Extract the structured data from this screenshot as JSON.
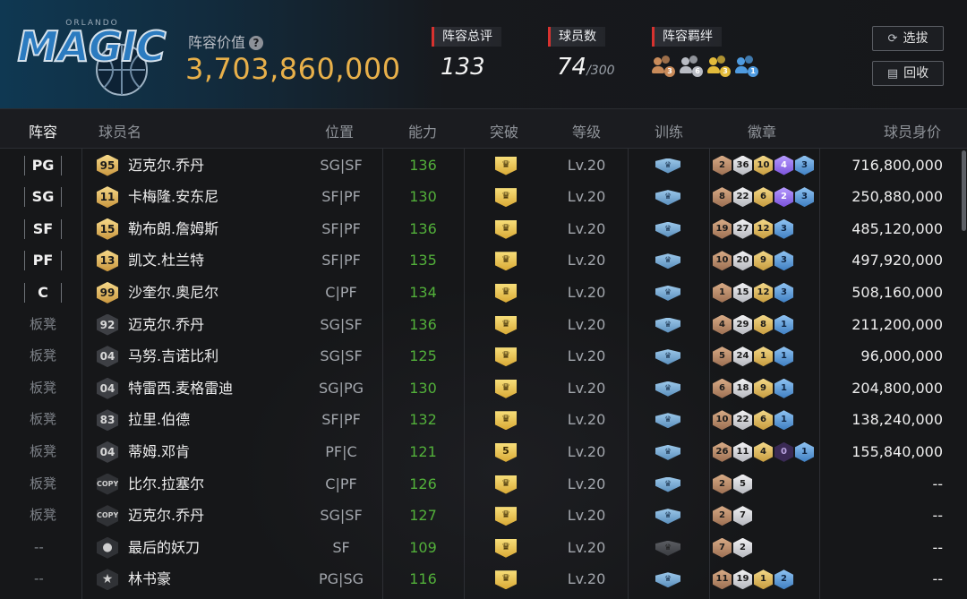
{
  "header": {
    "logo_text": "MAGIC",
    "logo_city": "ORLANDO",
    "lineup_value_label": "阵容价值",
    "lineup_value": "3,703,860,000",
    "stats": [
      {
        "label": "阵容总评",
        "value": "133",
        "sub": ""
      },
      {
        "label": "球员数",
        "value": "74",
        "sub": "/300"
      },
      {
        "label": "阵容羁绊",
        "value": "",
        "sub": ""
      }
    ],
    "bond_icons": [
      {
        "icon": "bronze-bond-icon",
        "badge": "3",
        "color": "#c98b5a"
      },
      {
        "icon": "silver-bond-icon",
        "badge": "6",
        "color": "#b9bcc4"
      },
      {
        "icon": "gold-bond-icon",
        "badge": "3",
        "color": "#e3bb3b"
      },
      {
        "icon": "blue-bond-icon",
        "badge": "1",
        "color": "#4f9be0"
      }
    ],
    "buttons": {
      "select": "选拔",
      "recycle": "回收"
    }
  },
  "columns": {
    "lineup": "阵容",
    "name": "球员名",
    "position": "位置",
    "rating": "能力",
    "breakthrough": "突破",
    "level": "等级",
    "training": "训练",
    "badges": "徽章",
    "salary": "球员身价"
  },
  "rows": [
    {
      "slot": "PG",
      "starter": true,
      "num": "95",
      "num_style": "gold",
      "name": "迈克尔.乔丹",
      "pos": "SG|SF",
      "rating": "136",
      "brk": "crown",
      "level": "Lv.20",
      "train": "normal",
      "badges": [
        {
          "v": "2",
          "t": "bronze"
        },
        {
          "v": "36",
          "t": "silver"
        },
        {
          "v": "10",
          "t": "gold"
        },
        {
          "v": "4",
          "t": "purple"
        },
        {
          "v": "3",
          "t": "blue"
        }
      ],
      "salary": "716,800,000"
    },
    {
      "slot": "SG",
      "starter": true,
      "num": "11",
      "num_style": "gold",
      "name": "卡梅隆.安东尼",
      "pos": "SF|PF",
      "rating": "130",
      "brk": "crown",
      "level": "Lv.20",
      "train": "normal",
      "badges": [
        {
          "v": "8",
          "t": "bronze"
        },
        {
          "v": "22",
          "t": "silver"
        },
        {
          "v": "6",
          "t": "gold"
        },
        {
          "v": "2",
          "t": "purple"
        },
        {
          "v": "3",
          "t": "blue"
        }
      ],
      "salary": "250,880,000"
    },
    {
      "slot": "SF",
      "starter": true,
      "num": "15",
      "num_style": "gold",
      "name": "勒布朗.詹姆斯",
      "pos": "SF|PF",
      "rating": "136",
      "brk": "crown",
      "level": "Lv.20",
      "train": "normal",
      "badges": [
        {
          "v": "19",
          "t": "bronze"
        },
        {
          "v": "27",
          "t": "silver"
        },
        {
          "v": "12",
          "t": "gold"
        },
        {
          "v": "3",
          "t": "blue"
        }
      ],
      "salary": "485,120,000"
    },
    {
      "slot": "PF",
      "starter": true,
      "num": "13",
      "num_style": "gold",
      "name": "凯文.杜兰特",
      "pos": "SF|PF",
      "rating": "135",
      "brk": "crown",
      "level": "Lv.20",
      "train": "normal",
      "badges": [
        {
          "v": "10",
          "t": "bronze"
        },
        {
          "v": "20",
          "t": "silver"
        },
        {
          "v": "9",
          "t": "gold"
        },
        {
          "v": "3",
          "t": "blue"
        }
      ],
      "salary": "497,920,000"
    },
    {
      "slot": "C",
      "starter": true,
      "num": "99",
      "num_style": "gold",
      "name": "沙奎尔.奥尼尔",
      "pos": "C|PF",
      "rating": "134",
      "brk": "crown",
      "level": "Lv.20",
      "train": "normal",
      "badges": [
        {
          "v": "1",
          "t": "bronze"
        },
        {
          "v": "15",
          "t": "silver"
        },
        {
          "v": "12",
          "t": "gold"
        },
        {
          "v": "3",
          "t": "blue"
        }
      ],
      "salary": "508,160,000"
    },
    {
      "slot": "板凳",
      "starter": false,
      "num": "92",
      "num_style": "gray",
      "name": "迈克尔.乔丹",
      "pos": "SG|SF",
      "rating": "136",
      "brk": "crown",
      "level": "Lv.20",
      "train": "normal",
      "badges": [
        {
          "v": "4",
          "t": "bronze"
        },
        {
          "v": "29",
          "t": "silver"
        },
        {
          "v": "8",
          "t": "gold"
        },
        {
          "v": "1",
          "t": "blue"
        }
      ],
      "salary": "211,200,000"
    },
    {
      "slot": "板凳",
      "starter": false,
      "num": "04",
      "num_style": "gray",
      "name": "马努.吉诺比利",
      "pos": "SG|SF",
      "rating": "125",
      "brk": "crown",
      "level": "Lv.20",
      "train": "normal",
      "badges": [
        {
          "v": "5",
          "t": "bronze"
        },
        {
          "v": "24",
          "t": "silver"
        },
        {
          "v": "1",
          "t": "gold"
        },
        {
          "v": "1",
          "t": "blue"
        }
      ],
      "salary": "96,000,000"
    },
    {
      "slot": "板凳",
      "starter": false,
      "num": "04",
      "num_style": "gray",
      "name": "特雷西.麦格雷迪",
      "pos": "SG|PG",
      "rating": "130",
      "brk": "crown",
      "level": "Lv.20",
      "train": "normal",
      "badges": [
        {
          "v": "6",
          "t": "bronze"
        },
        {
          "v": "18",
          "t": "silver"
        },
        {
          "v": "9",
          "t": "gold"
        },
        {
          "v": "1",
          "t": "blue"
        }
      ],
      "salary": "204,800,000"
    },
    {
      "slot": "板凳",
      "starter": false,
      "num": "83",
      "num_style": "gray",
      "name": "拉里.伯德",
      "pos": "SF|PF",
      "rating": "132",
      "brk": "crown",
      "level": "Lv.20",
      "train": "normal",
      "badges": [
        {
          "v": "10",
          "t": "bronze"
        },
        {
          "v": "22",
          "t": "silver"
        },
        {
          "v": "6",
          "t": "gold"
        },
        {
          "v": "1",
          "t": "blue"
        }
      ],
      "salary": "138,240,000"
    },
    {
      "slot": "板凳",
      "starter": false,
      "num": "04",
      "num_style": "gray",
      "name": "蒂姆.邓肯",
      "pos": "PF|C",
      "rating": "121",
      "brk": "5",
      "level": "Lv.20",
      "train": "normal",
      "badges": [
        {
          "v": "26",
          "t": "bronze"
        },
        {
          "v": "11",
          "t": "silver"
        },
        {
          "v": "4",
          "t": "gold"
        },
        {
          "v": "0",
          "t": "dark"
        },
        {
          "v": "1",
          "t": "blue"
        }
      ],
      "salary": "155,840,000"
    },
    {
      "slot": "板凳",
      "starter": false,
      "num": "COPY",
      "num_style": "copy",
      "name": "比尔.拉塞尔",
      "pos": "C|PF",
      "rating": "126",
      "brk": "crown",
      "level": "Lv.20",
      "train": "normal",
      "badges": [
        {
          "v": "2",
          "t": "bronze"
        },
        {
          "v": "5",
          "t": "silver"
        }
      ],
      "salary": "--"
    },
    {
      "slot": "板凳",
      "starter": false,
      "num": "COPY",
      "num_style": "copy",
      "name": "迈克尔.乔丹",
      "pos": "SG|SF",
      "rating": "127",
      "brk": "crown",
      "level": "Lv.20",
      "train": "normal",
      "badges": [
        {
          "v": "2",
          "t": "bronze"
        },
        {
          "v": "7",
          "t": "silver"
        }
      ],
      "salary": "--"
    },
    {
      "slot": "--",
      "starter": false,
      "num": "user-icon",
      "num_style": "user",
      "name": "最后的妖刀",
      "pos": "SF",
      "rating": "109",
      "brk": "crown",
      "level": "Lv.20",
      "train": "dim",
      "badges": [
        {
          "v": "7",
          "t": "bronze"
        },
        {
          "v": "2",
          "t": "silver"
        }
      ],
      "salary": "--"
    },
    {
      "slot": "--",
      "starter": false,
      "num": "star-icon",
      "num_style": "star",
      "name": "林书豪",
      "pos": "PG|SG",
      "rating": "116",
      "brk": "crown",
      "level": "Lv.20",
      "train": "normal",
      "badges": [
        {
          "v": "11",
          "t": "bronze"
        },
        {
          "v": "19",
          "t": "silver"
        },
        {
          "v": "1",
          "t": "gold"
        },
        {
          "v": "2",
          "t": "blue"
        }
      ],
      "salary": "--"
    }
  ]
}
